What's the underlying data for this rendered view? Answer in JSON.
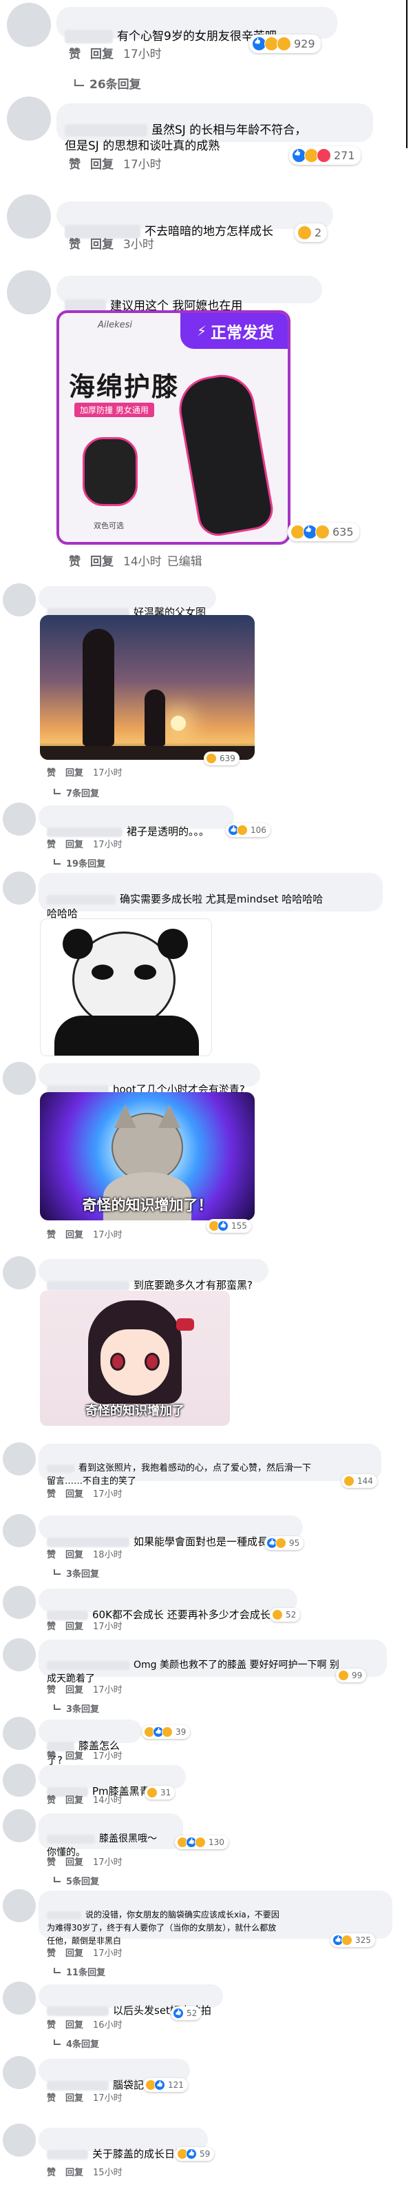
{
  "labels": {
    "like": "赞",
    "reply": "回复",
    "edited": "已编辑"
  },
  "comments": [
    {
      "text": "有个心智9岁的女朋友很辛苦吧",
      "time": "17小时",
      "count": "929",
      "replies": "26条回复"
    },
    {
      "text": "虽然SJ 的长相与年龄不符合，\n但是SJ 的思想和谈吐真的成熟",
      "time": "17小时",
      "count": "271"
    },
    {
      "text": "不去暗暗的地方怎样成长",
      "time": "3小时",
      "count": "2"
    },
    {
      "text": "建议用这个 我阿嬷也在用",
      "time": "14小时",
      "count": "635",
      "ad": {
        "brand": "Ailekesi",
        "banner": "正常发货",
        "title": "海绵护膝",
        "sub": "加厚防撞 男女通用",
        "color": "双色可选"
      }
    },
    {
      "text": "好温馨的父女图",
      "time": "17小时",
      "count": "639",
      "replies": "7条回复"
    },
    {
      "text": "裙子是透明的。。。",
      "time": "17小时",
      "count": "106",
      "replies": "19条回复"
    },
    {
      "text": "确实需要多成长啦 尤其是mindset 哈哈哈哈\n哈哈哈"
    },
    {
      "text": "hoot了几个小时才会有淤青?",
      "time": "17小时",
      "count": "155",
      "meme": "奇怪的知识增加了！"
    },
    {
      "text": "到底要跪多久才有那蛮黑?",
      "meme": "奇怪的知识增加了"
    },
    {
      "text": "看到这张照片，我抱着感动的心，点了爱心赞，然后滑一下\n留言……不自主的笑了",
      "time": "17小时",
      "count": "144"
    },
    {
      "text": "如果能學會面對也是一種成長。",
      "time": "18小时",
      "count": "95",
      "replies": "3条回复"
    },
    {
      "text": "60K都不会成长 还要再补多少才会成长",
      "time": "17小时",
      "count": "52"
    },
    {
      "text": "Omg 美颜也救不了的膝盖 要好好呵护一下啊 别\n成天跪着了",
      "time": "17小时",
      "count": "99",
      "replies": "3条回复"
    },
    {
      "text": "膝盖怎么了?",
      "time": "17小时",
      "count": "39"
    },
    {
      "text": "Pm膝盖黑青故事",
      "time": "14小时",
      "count": "31"
    },
    {
      "text": "膝盖很黑哦～\n你懂的。",
      "time": "17小时",
      "count": "130",
      "replies": "5条回复"
    },
    {
      "text": "说的没错，你女朋友的脑袋确实应该成长xia，不要因\n为难得30岁了，终于有人要你了（当你的女朋友），就什么都放\n任他，颠倒是非黑白",
      "time": "17小时",
      "count": "325",
      "replies": "11条回复"
    },
    {
      "text": "以后头发set好来才拍",
      "time": "16小时",
      "count": "52",
      "replies": "4条回复"
    },
    {
      "text": "腦袋記得先跪",
      "time": "17小时",
      "count": "121"
    },
    {
      "text": "关于膝盖的成长日记",
      "time": "15小时",
      "count": "59"
    }
  ]
}
